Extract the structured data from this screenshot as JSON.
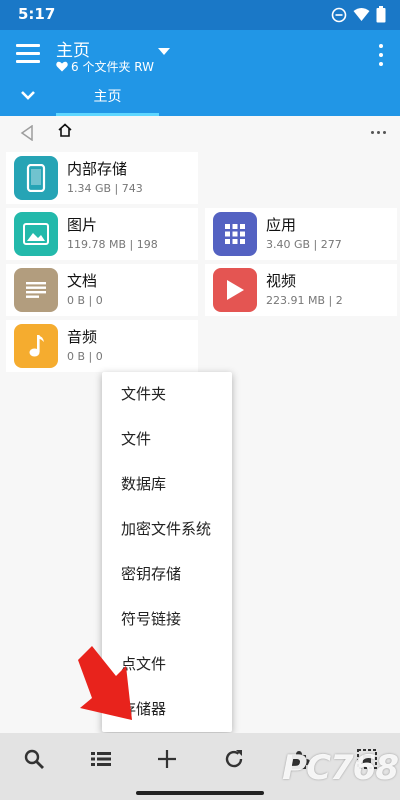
{
  "status_bar": {
    "time": "5:17"
  },
  "app_bar": {
    "title": "主页",
    "subtitle": "6 个文件夹 RW"
  },
  "tabs": [
    {
      "label": "主页"
    }
  ],
  "tiles": [
    {
      "name": "内部存储",
      "meta": "1.34 GB | 743",
      "icon": "phone-icon",
      "color": "#26a4b5"
    },
    {
      "name": "图片",
      "meta": "119.78 MB | 198",
      "icon": "image-icon",
      "color": "#23b9ab"
    },
    {
      "name": "应用",
      "meta": "3.40 GB | 277",
      "icon": "apps-grid-icon",
      "color": "#5462c2"
    },
    {
      "name": "文档",
      "meta": "0 B | 0",
      "icon": "document-icon",
      "color": "#b29d7e"
    },
    {
      "name": "视频",
      "meta": "223.91 MB | 2",
      "icon": "play-icon",
      "color": "#e45552"
    },
    {
      "name": "音频",
      "meta": "0 B | 0",
      "icon": "music-note-icon",
      "color": "#f5ac2f"
    }
  ],
  "popup_menu": {
    "items": [
      "文件夹",
      "文件",
      "数据库",
      "加密文件系统",
      "密钥存储",
      "符号链接",
      "点文件",
      "存储器"
    ]
  },
  "watermark": {
    "text": "PC768"
  },
  "colors": {
    "status_bar": "#1a78c7",
    "app_bar": "#2196e6",
    "tab_indicator": "#5fd7ff",
    "arrow": "#e8231c"
  }
}
